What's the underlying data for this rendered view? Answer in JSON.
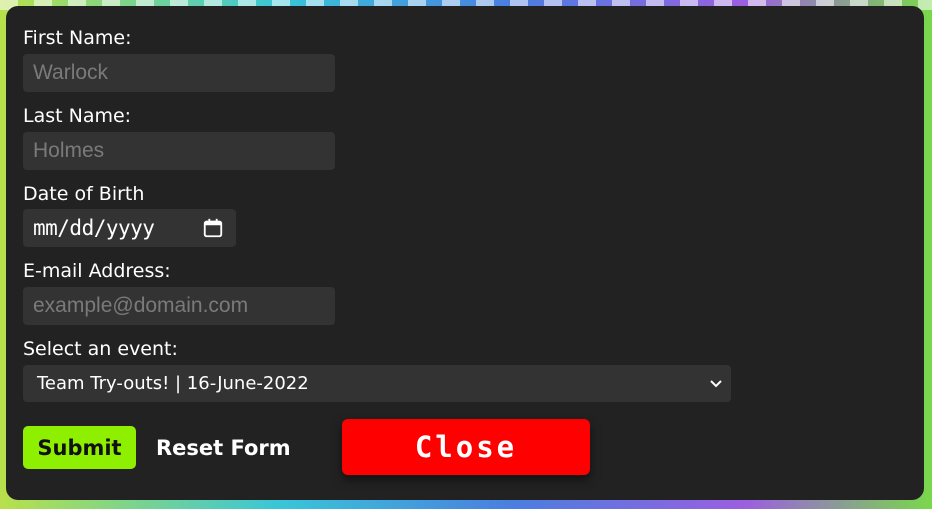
{
  "form": {
    "first_name_label": "First Name:",
    "first_name_placeholder": "Warlock",
    "last_name_label": "Last Name:",
    "last_name_placeholder": "Holmes",
    "dob_label": "Date of Birth",
    "dob_value": "mm/dd/yyyy",
    "email_label": "E-mail Address:",
    "email_placeholder": "example@domain.com",
    "event_label": "Select an event:",
    "event_selected": "Team Try-outs! | 16-June-2022"
  },
  "buttons": {
    "submit": "Submit",
    "reset": "Reset Form",
    "close": "Close"
  },
  "colors": {
    "panel": "#222222",
    "field": "#333333",
    "submit": "#8ef000",
    "close": "#ff0000"
  },
  "icons": {
    "date": "calendar-icon",
    "select": "chevron-down-icon"
  }
}
